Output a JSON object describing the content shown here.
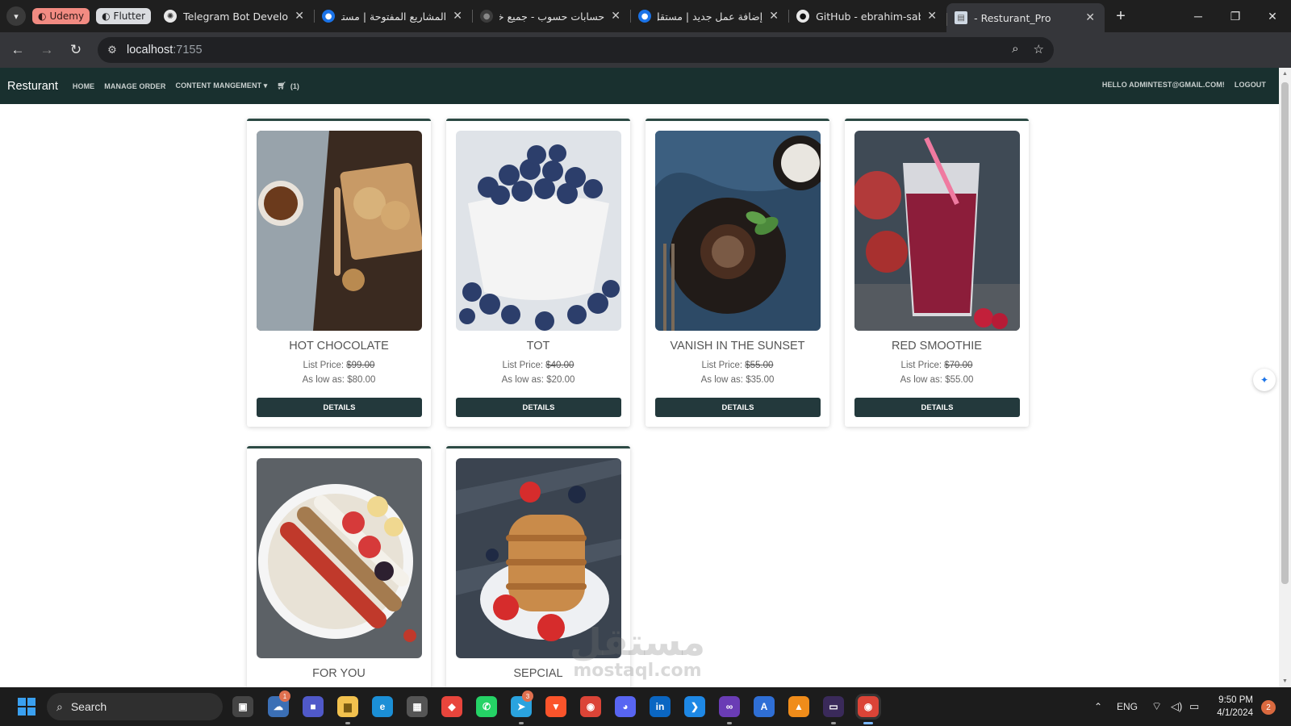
{
  "browser": {
    "tab_groups": [
      {
        "label": "Udemy",
        "color": "#f28b82"
      },
      {
        "label": "Flutter",
        "color": "#dadce0"
      }
    ],
    "tabs": [
      {
        "title": "Telegram Bot Developm",
        "icon": "openai-icon",
        "active": false
      },
      {
        "title": "المشاريع المفتوحة | مستق",
        "icon": "mostaql-icon",
        "active": false
      },
      {
        "title": "حسابات حسوب - جميع خد",
        "icon": "hsoub-icon",
        "active": false
      },
      {
        "title": "إضافة عمل جديد | مستقل",
        "icon": "mostaql-icon",
        "active": false
      },
      {
        "title": "GitHub - ebrahim-saber",
        "icon": "github-icon",
        "active": false
      },
      {
        "title": "- Resturant_Pro",
        "icon": "page-icon",
        "active": true
      }
    ],
    "url_host": "localhost",
    "url_port": ":7155"
  },
  "site": {
    "brand": "Resturant",
    "nav": {
      "home": "HOME",
      "manage_order": "MANAGE ORDER",
      "content_management": "CONTENT MANGEMENT",
      "cart_count": "(1)"
    },
    "user": {
      "greeting": "HELLO ADMINTEST@GMAIL.COM!",
      "logout": "LOGOUT"
    },
    "details_label": "DETAILS",
    "list_price_label": "List Price:",
    "low_price_label": "As low as:",
    "products": [
      {
        "name": "HOT CHOCOLATE",
        "list_price": "$99.00",
        "low_price": "$80.00",
        "image": "hot-chocolate-photo"
      },
      {
        "name": "TOT",
        "list_price": "$40.00",
        "low_price": "$20.00",
        "image": "blueberries-photo"
      },
      {
        "name": "VANISH IN THE SUNSET",
        "list_price": "$55.00",
        "low_price": "$35.00",
        "image": "chocolate-cake-photo"
      },
      {
        "name": "RED SMOOTHIE",
        "list_price": "$70.00",
        "low_price": "$55.00",
        "image": "red-smoothie-photo"
      },
      {
        "name": "FOR YOU",
        "list_price": "",
        "low_price": "",
        "image": "fruit-bowl-photo"
      },
      {
        "name": "SEPCIAL",
        "list_price": "",
        "low_price": "",
        "image": "pancakes-photo"
      }
    ]
  },
  "watermark": {
    "arabic": "مستقل",
    "latin": "mostaql.com"
  },
  "taskbar": {
    "search_label": "Search",
    "language": "ENG",
    "time": "9:50 PM",
    "date": "4/1/2024",
    "notification_count": "2",
    "badges": {
      "weather": "1",
      "telegram": "3"
    }
  },
  "colors": {
    "navbar": "#19302f",
    "button": "#23393c",
    "card_border": "#2c4a44",
    "browser_frame": "#1f1f1f",
    "toolbar": "#35363a"
  }
}
